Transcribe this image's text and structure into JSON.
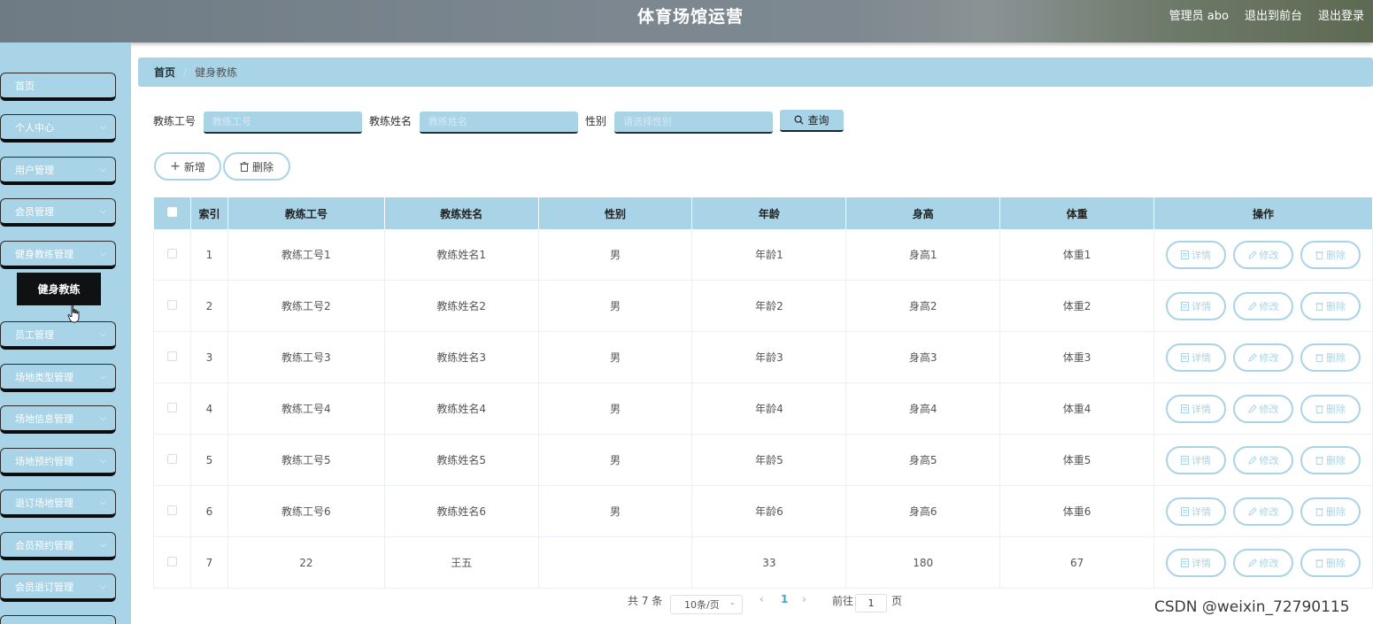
{
  "header": {
    "title": "体育场馆运营",
    "user": "管理员 abo",
    "front_link": "退出到前台",
    "logout": "退出登录"
  },
  "sidebar": {
    "items": [
      {
        "label": "首页",
        "chevron": false
      },
      {
        "label": "个人中心",
        "chevron": true
      },
      {
        "label": "用户管理",
        "chevron": true
      },
      {
        "label": "会员管理",
        "chevron": true
      },
      {
        "label": "健身教练管理",
        "chevron": true
      },
      {
        "label": "员工管理",
        "chevron": true
      },
      {
        "label": "场地类型管理",
        "chevron": true
      },
      {
        "label": "场地信息管理",
        "chevron": true
      },
      {
        "label": "场地预约管理",
        "chevron": true
      },
      {
        "label": "退订场地管理",
        "chevron": true
      },
      {
        "label": "会员预约管理",
        "chevron": true
      },
      {
        "label": "会员退订管理",
        "chevron": true
      }
    ],
    "submenu_label": "健身教练"
  },
  "breadcrumb": {
    "home": "首页",
    "separator": "/",
    "current": "健身教练"
  },
  "search": {
    "field1_label": "教练工号",
    "field1_placeholder": "教练工号",
    "field2_label": "教练姓名",
    "field2_placeholder": "教练姓名",
    "field3_label": "性别",
    "field3_placeholder": "请选择性别",
    "query_label": "查询"
  },
  "actions": {
    "add_label": "新增",
    "delete_label": "删除"
  },
  "table": {
    "headers": [
      "索引",
      "教练工号",
      "教练姓名",
      "性别",
      "年龄",
      "身高",
      "体重",
      "操作"
    ],
    "rows": [
      [
        "1",
        "教练工号1",
        "教练姓名1",
        "男",
        "年龄1",
        "身高1",
        "体重1"
      ],
      [
        "2",
        "教练工号2",
        "教练姓名2",
        "男",
        "年龄2",
        "身高2",
        "体重2"
      ],
      [
        "3",
        "教练工号3",
        "教练姓名3",
        "男",
        "年龄3",
        "身高3",
        "体重3"
      ],
      [
        "4",
        "教练工号4",
        "教练姓名4",
        "男",
        "年龄4",
        "身高4",
        "体重4"
      ],
      [
        "5",
        "教练工号5",
        "教练姓名5",
        "男",
        "年龄5",
        "身高5",
        "体重5"
      ],
      [
        "6",
        "教练工号6",
        "教练姓名6",
        "男",
        "年龄6",
        "身高6",
        "体重6"
      ],
      [
        "7",
        "22",
        "王五",
        "",
        "33",
        "180",
        "67"
      ]
    ],
    "op_detail": "详情",
    "op_edit": "修改",
    "op_delete": "删除"
  },
  "pagination": {
    "total": "共 7 条",
    "page_size": "10条/页",
    "current_page": "1",
    "goto_label": "前往",
    "goto_value": "1",
    "page_suffix": "页"
  },
  "watermark": "CSDN @weixin_72790115",
  "colors": {
    "accent": "#a9d3e6",
    "submenu_active_bg": "#0f1213"
  }
}
